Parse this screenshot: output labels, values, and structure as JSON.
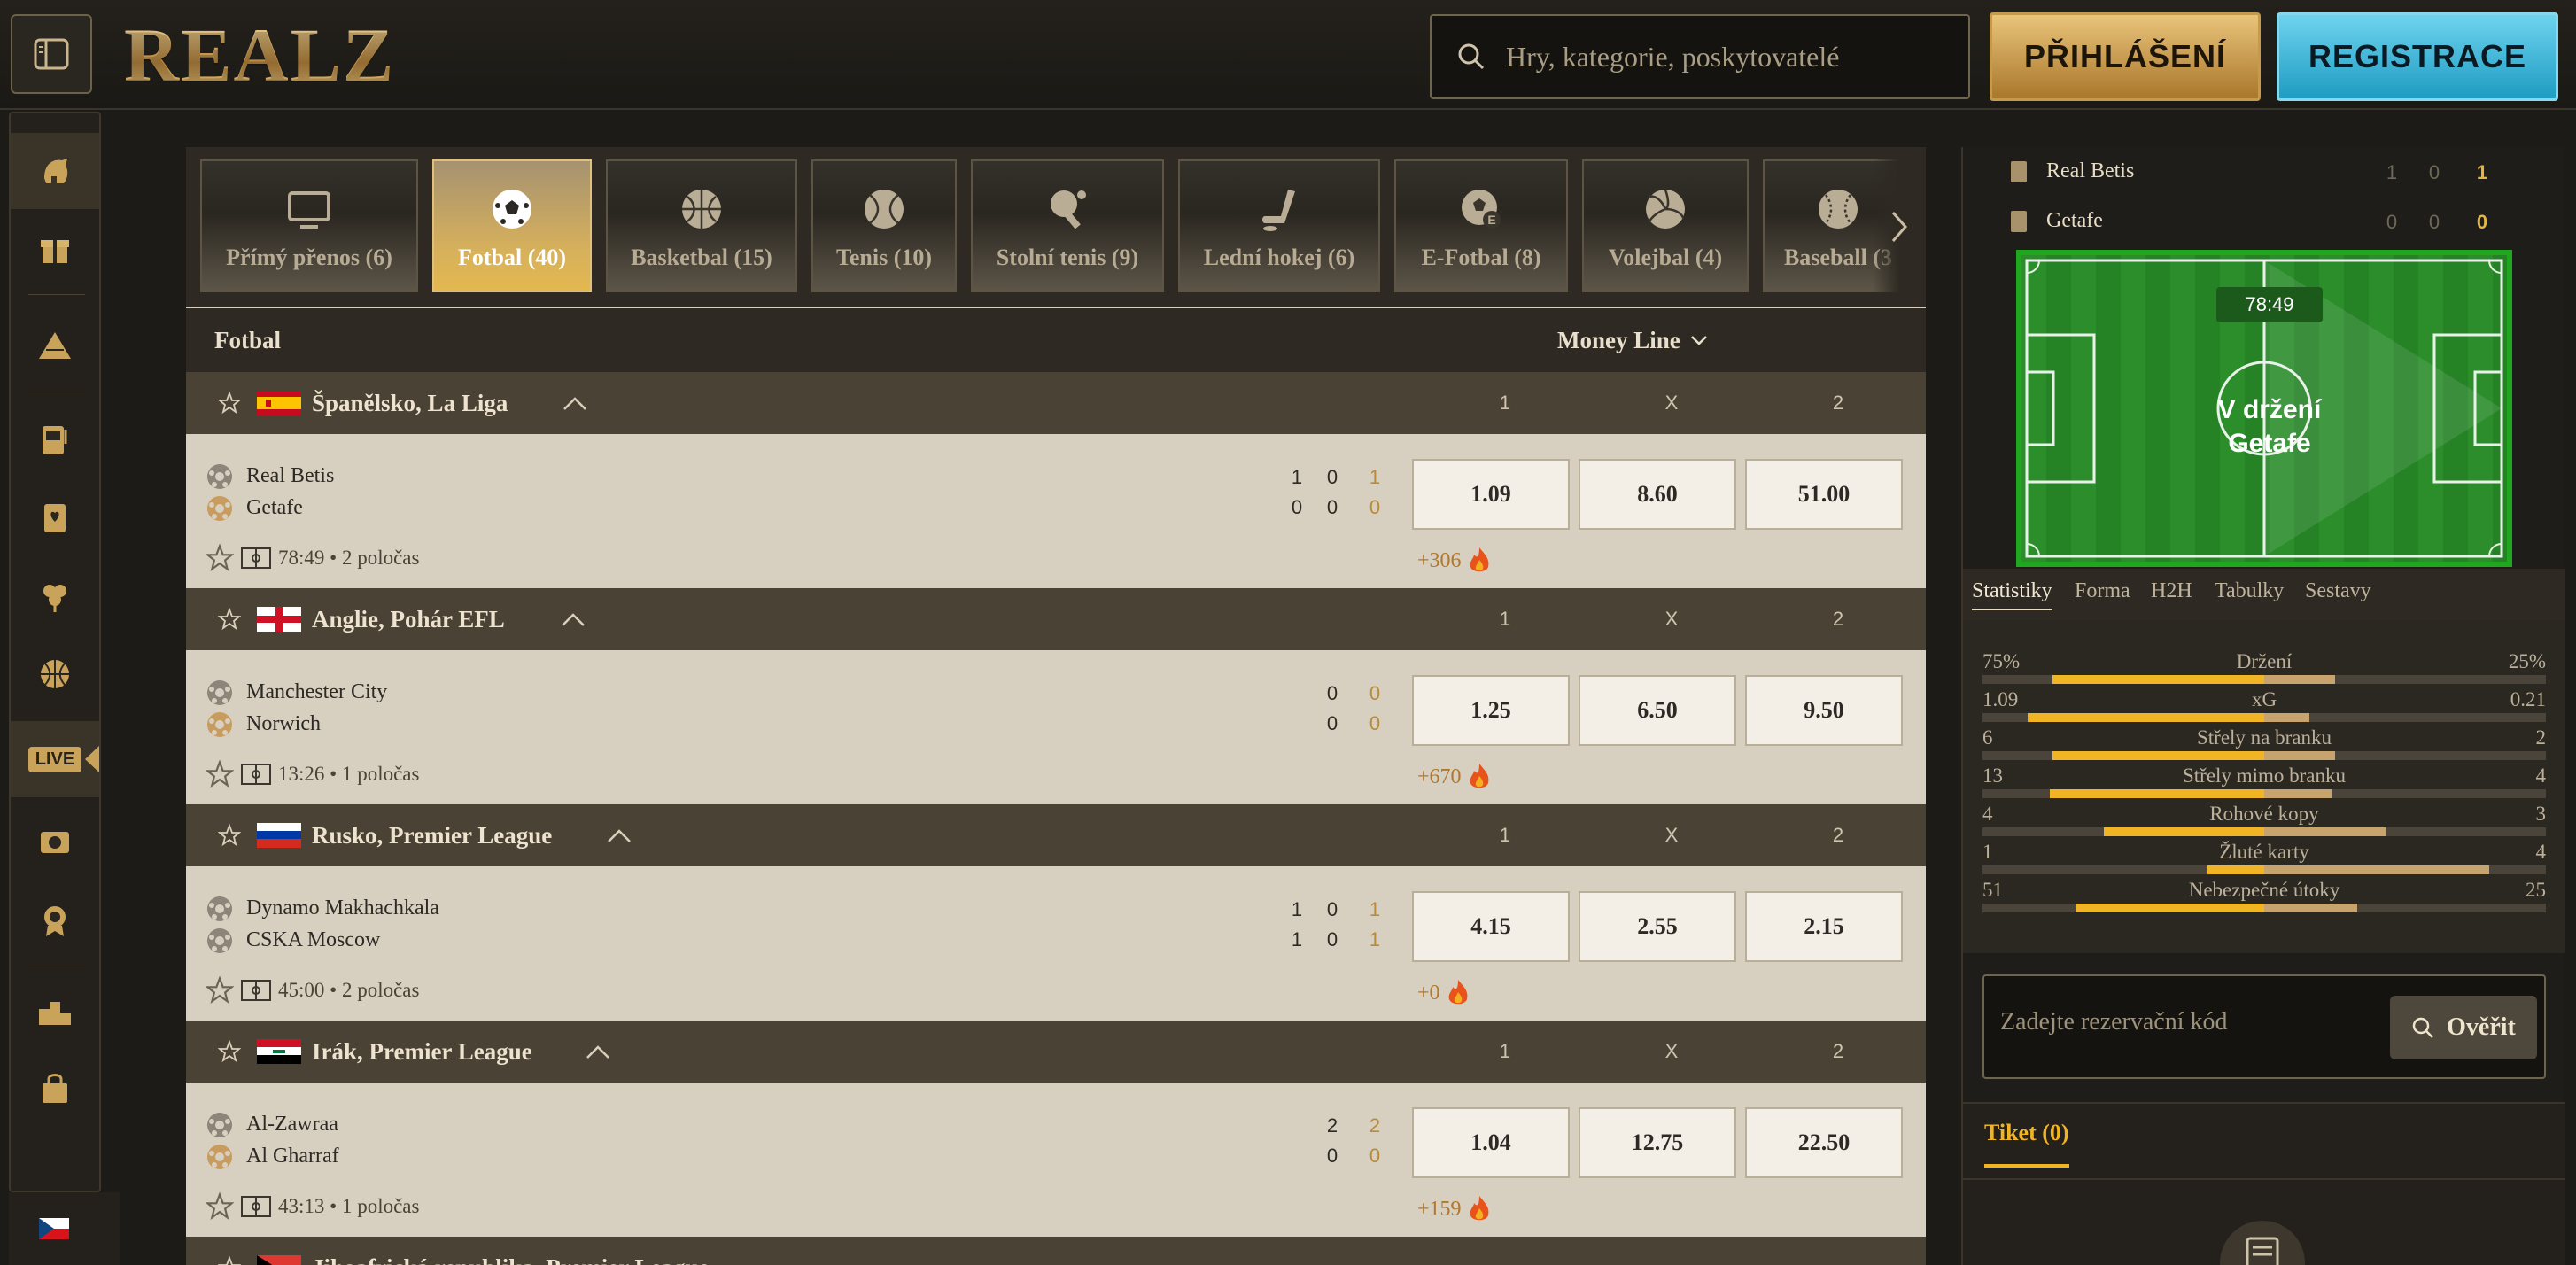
{
  "header": {
    "logo_text": "REALZ",
    "search_placeholder": "Hry, kategorie, poskytovatelé",
    "login_label": "PŘIHLÁŠENÍ",
    "register_label": "REGISTRACE"
  },
  "sidebar": {
    "items": [
      {
        "icon": "spartan-helmet-icon"
      },
      {
        "icon": "gift-icon"
      },
      {
        "icon": "pyramid-icon"
      },
      {
        "icon": "slot-machine-icon"
      },
      {
        "icon": "playing-card-icon"
      },
      {
        "icon": "clover-icon"
      },
      {
        "icon": "basketball-icon"
      },
      {
        "icon": "live-icon",
        "label": "LIVE"
      },
      {
        "icon": "virtual-sports-icon"
      },
      {
        "icon": "badge-icon"
      },
      {
        "icon": "podium-icon"
      },
      {
        "icon": "shopping-bag-icon"
      }
    ],
    "language_flag": "flag-cz-icon"
  },
  "sports": [
    {
      "label": "Přímý přenos (6)",
      "icon": "tv-icon"
    },
    {
      "label": "Fotbal (40)",
      "icon": "soccer-ball-icon",
      "active": true
    },
    {
      "label": "Basketbal (15)",
      "icon": "basketball-icon"
    },
    {
      "label": "Tenis (10)",
      "icon": "tennis-ball-icon"
    },
    {
      "label": "Stolní tenis (9)",
      "icon": "table-tennis-icon"
    },
    {
      "label": "Lední hokej (6)",
      "icon": "ice-hockey-icon"
    },
    {
      "label": "E-Fotbal (8)",
      "icon": "e-football-icon"
    },
    {
      "label": "Volejbal (4)",
      "icon": "volleyball-icon"
    },
    {
      "label": "Baseball (3",
      "icon": "baseball-icon"
    }
  ],
  "list": {
    "title": "Fotbal",
    "market": "Money Line",
    "col1": "1",
    "colx": "X",
    "col2": "2"
  },
  "leagues": [
    {
      "name": "Španělsko, La Liga",
      "flag": "spain",
      "match": {
        "home": "Real Betis",
        "away": "Getafe",
        "home_scores": [
          "1",
          "0",
          "1"
        ],
        "away_scores": [
          "0",
          "0",
          "0"
        ],
        "time": "78:49 • 2 poločas",
        "odds": [
          "1.09",
          "8.60",
          "51.00"
        ],
        "more": "+306"
      }
    },
    {
      "name": "Anglie, Pohár EFL",
      "flag": "england",
      "match": {
        "home": "Manchester City",
        "away": "Norwich",
        "home_scores": [
          "0",
          "0"
        ],
        "away_scores": [
          "0",
          "0"
        ],
        "time": "13:26 • 1 poločas",
        "odds": [
          "1.25",
          "6.50",
          "9.50"
        ],
        "more": "+670"
      }
    },
    {
      "name": "Rusko, Premier League",
      "flag": "russia",
      "match": {
        "home": "Dynamo Makhachkala",
        "away": "CSKA Moscow",
        "home_scores": [
          "1",
          "0",
          "1"
        ],
        "away_scores": [
          "1",
          "0",
          "1"
        ],
        "time": "45:00 • 2 poločas",
        "odds": [
          "4.15",
          "2.55",
          "2.15"
        ],
        "more": "+0"
      }
    },
    {
      "name": "Irák, Premier League",
      "flag": "iraq",
      "match": {
        "home": "Al-Zawraa",
        "away": "Al Gharraf",
        "home_scores": [
          "2",
          "2"
        ],
        "away_scores": [
          "0",
          "0"
        ],
        "time": "43:13 • 1 poločas",
        "odds": [
          "1.04",
          "12.75",
          "22.50"
        ],
        "more": "+159"
      }
    }
  ],
  "next_league": "Jihoafrická republika, Premier League",
  "right": {
    "home": "Real Betis",
    "away": "Getafe",
    "home_scores": [
      "1",
      "0",
      "1"
    ],
    "away_scores": [
      "0",
      "0",
      "0"
    ],
    "pitch_time": "78:49",
    "pitch_text_1": "V držení",
    "pitch_text_2": "Getafe",
    "tabs": [
      "Statistiky",
      "Forma",
      "H2H",
      "Tabulky",
      "Sestavy"
    ],
    "stats": [
      {
        "label": "Držení",
        "home": "75%",
        "away": "25%",
        "home_frac": 0.75,
        "away_frac": 0.25
      },
      {
        "label": "xG",
        "home": "1.09",
        "away": "0.21",
        "home_frac": 0.84,
        "away_frac": 0.16
      },
      {
        "label": "Střely na branku",
        "home": "6",
        "away": "2",
        "home_frac": 0.75,
        "away_frac": 0.25
      },
      {
        "label": "Střely mimo branku",
        "home": "13",
        "away": "4",
        "home_frac": 0.76,
        "away_frac": 0.24
      },
      {
        "label": "Rohové kopy",
        "home": "4",
        "away": "3",
        "home_frac": 0.57,
        "away_frac": 0.43
      },
      {
        "label": "Žluté karty",
        "home": "1",
        "away": "4",
        "home_frac": 0.2,
        "away_frac": 0.8
      },
      {
        "label": "Nebezpečné útoky",
        "home": "51",
        "away": "25",
        "home_frac": 0.67,
        "away_frac": 0.33
      }
    ],
    "booking_placeholder": "Zadejte rezervační kód",
    "verify_label": "Ověřit",
    "ticket_label": "Tiket (0)"
  },
  "colors": {
    "accent_gold": "#f0b424",
    "register_blue": "#1e9cc2",
    "pitch_green": "#2b8e2b"
  }
}
